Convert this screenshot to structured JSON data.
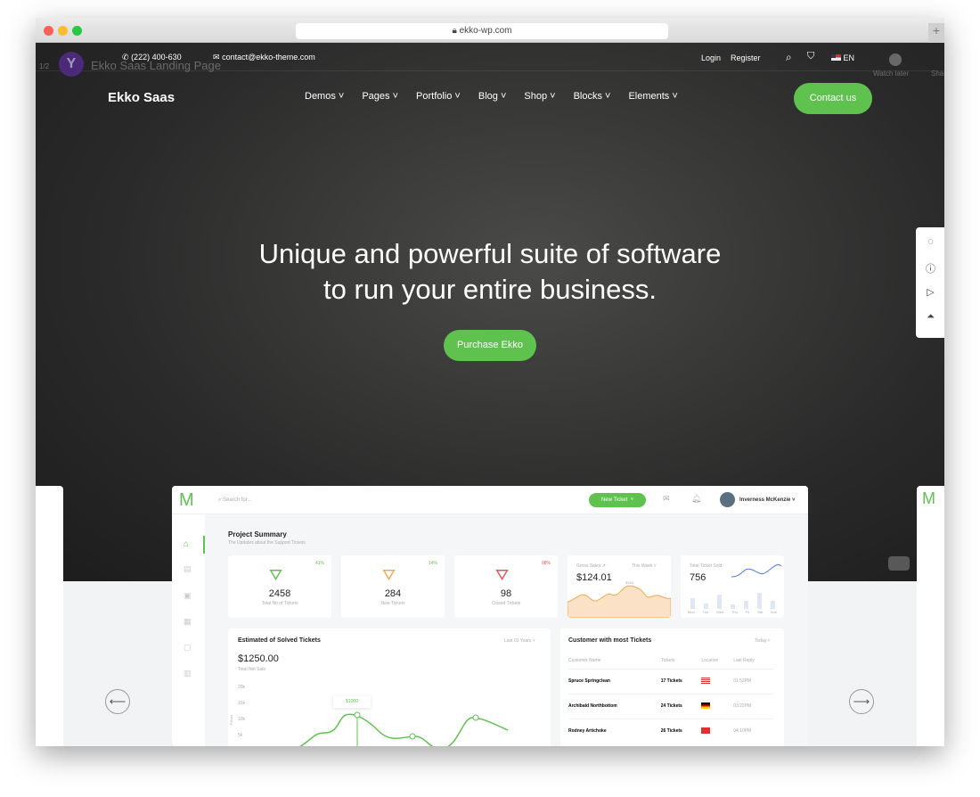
{
  "browser": {
    "url": "ekko-wp.com"
  },
  "overlay": {
    "counter": "1/2",
    "video_title": "Ekko Saas Landing Page",
    "watch_later": "Watch later",
    "share": "Share",
    "channel_initial": "Y"
  },
  "topbar": {
    "phone": "(222) 400-630",
    "email": "contact@ekko-theme.com",
    "login": "Login",
    "register": "Register",
    "language": "EN"
  },
  "nav": {
    "logo": "Ekko Saas",
    "items": [
      "Demos",
      "Pages",
      "Portfolio",
      "Blog",
      "Shop",
      "Blocks",
      "Elements"
    ],
    "cta": "Contact us"
  },
  "hero": {
    "line1": "Unique and powerful suite of software",
    "line2": "to run your entire business.",
    "button": "Purchase Ekko"
  },
  "colors": {
    "accent": "#5fc24f",
    "orange": "#f0a952",
    "red": "#e0555a",
    "blue": "#4a7de0"
  },
  "dashboard": {
    "search_placeholder": "Search for...",
    "new_ticket": "New Ticket",
    "user": "Inverness McKenzie",
    "summary_title": "Project Summary",
    "summary_sub": "The Updates about the Support Tickets",
    "stats": [
      {
        "pct": "41%",
        "value": "2458",
        "label": "Total No of Tickets"
      },
      {
        "pct": "14%",
        "value": "284",
        "label": "New Tickets"
      },
      {
        "pct": "08%",
        "value": "98",
        "label": "Closed Tickets"
      }
    ],
    "gross": {
      "label": "Gross Sales",
      "period": "This Week",
      "value": "$124.01",
      "tip": "$254"
    },
    "sold": {
      "label": "Total Ticket Sold",
      "value": "756",
      "days": [
        "Mon",
        "Tue",
        "Wed",
        "Thu",
        "Fri",
        "Sat",
        "Sun"
      ],
      "bars": [
        45,
        22,
        60,
        18,
        35,
        70,
        35
      ]
    },
    "solved": {
      "title": "Estimated of Solved Tickets",
      "period": "Last 01 Years",
      "value": "$1250.00",
      "sub": "Total Net Sale",
      "tip": "$1000",
      "ylabel": "Prices",
      "yticks": [
        "20k",
        "15k",
        "10k",
        "5k"
      ]
    },
    "customers": {
      "title": "Customer with most Tickets",
      "period": "Today",
      "headers": [
        "Customer Name",
        "Tickets",
        "Location",
        "Last Reply"
      ],
      "rows": [
        {
          "name": "Spruce Springclean",
          "tickets": "17 Tickets",
          "flag": "us",
          "time": "01:52PM"
        },
        {
          "name": "Archibald Northbottom",
          "tickets": "24 Tickets",
          "flag": "de",
          "time": "03:22PM"
        },
        {
          "name": "Rodney Artichoke",
          "tickets": "26 Tickets",
          "flag": "cn",
          "time": "04:10PM"
        }
      ]
    }
  }
}
